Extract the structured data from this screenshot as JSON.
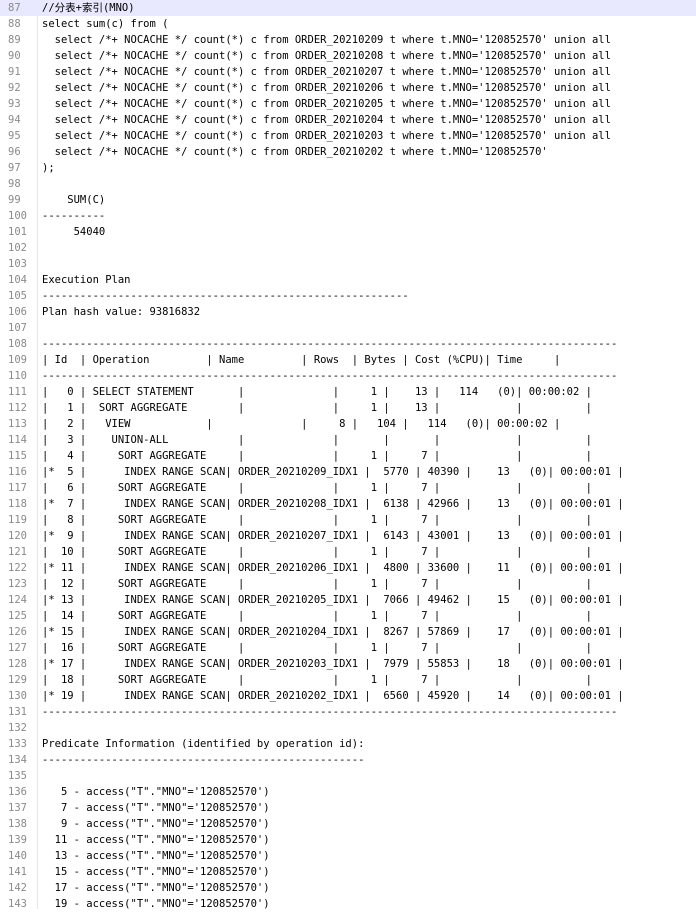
{
  "editor": {
    "lines": [
      {
        "n": "87",
        "t": "//分表+索引(MNO)"
      },
      {
        "n": "88",
        "t": "select sum(c) from ("
      },
      {
        "n": "89",
        "t": "  select /*+ NOCACHE */ count(*) c from ORDER_20210209 t where t.MNO='120852570' union all"
      },
      {
        "n": "90",
        "t": "  select /*+ NOCACHE */ count(*) c from ORDER_20210208 t where t.MNO='120852570' union all"
      },
      {
        "n": "91",
        "t": "  select /*+ NOCACHE */ count(*) c from ORDER_20210207 t where t.MNO='120852570' union all"
      },
      {
        "n": "92",
        "t": "  select /*+ NOCACHE */ count(*) c from ORDER_20210206 t where t.MNO='120852570' union all"
      },
      {
        "n": "93",
        "t": "  select /*+ NOCACHE */ count(*) c from ORDER_20210205 t where t.MNO='120852570' union all"
      },
      {
        "n": "94",
        "t": "  select /*+ NOCACHE */ count(*) c from ORDER_20210204 t where t.MNO='120852570' union all"
      },
      {
        "n": "95",
        "t": "  select /*+ NOCACHE */ count(*) c from ORDER_20210203 t where t.MNO='120852570' union all"
      },
      {
        "n": "96",
        "t": "  select /*+ NOCACHE */ count(*) c from ORDER_20210202 t where t.MNO='120852570'"
      },
      {
        "n": "97",
        "t": ");"
      },
      {
        "n": "98",
        "t": ""
      },
      {
        "n": "99",
        "t": "    SUM(C)"
      },
      {
        "n": "100",
        "t": "----------"
      },
      {
        "n": "101",
        "t": "     54040"
      },
      {
        "n": "102",
        "t": ""
      },
      {
        "n": "103",
        "t": ""
      },
      {
        "n": "104",
        "t": "Execution Plan"
      },
      {
        "n": "105",
        "t": "----------------------------------------------------------"
      },
      {
        "n": "106",
        "t": "Plan hash value: 93816832"
      },
      {
        "n": "107",
        "t": ""
      },
      {
        "n": "108",
        "t": "-------------------------------------------------------------------------------------------"
      },
      {
        "n": "109",
        "t": "| Id  | Operation         | Name         | Rows  | Bytes | Cost (%CPU)| Time     |"
      },
      {
        "n": "110",
        "t": "-------------------------------------------------------------------------------------------"
      },
      {
        "n": "111",
        "t": "|   0 | SELECT STATEMENT       |              |     1 |    13 |   114   (0)| 00:00:02 |"
      },
      {
        "n": "112",
        "t": "|   1 |  SORT AGGREGATE        |              |     1 |    13 |            |          |"
      },
      {
        "n": "113",
        "t": "|   2 |   VIEW            |              |     8 |   104 |   114   (0)| 00:00:02 |"
      },
      {
        "n": "114",
        "t": "|   3 |    UNION-ALL           |              |       |       |            |          |"
      },
      {
        "n": "115",
        "t": "|   4 |     SORT AGGREGATE     |              |     1 |     7 |            |          |"
      },
      {
        "n": "116",
        "t": "|*  5 |      INDEX RANGE SCAN| ORDER_20210209_IDX1 |  5770 | 40390 |    13   (0)| 00:00:01 |"
      },
      {
        "n": "117",
        "t": "|   6 |     SORT AGGREGATE     |              |     1 |     7 |            |          |"
      },
      {
        "n": "118",
        "t": "|*  7 |      INDEX RANGE SCAN| ORDER_20210208_IDX1 |  6138 | 42966 |    13   (0)| 00:00:01 |"
      },
      {
        "n": "119",
        "t": "|   8 |     SORT AGGREGATE     |              |     1 |     7 |            |          |"
      },
      {
        "n": "120",
        "t": "|*  9 |      INDEX RANGE SCAN| ORDER_20210207_IDX1 |  6143 | 43001 |    13   (0)| 00:00:01 |"
      },
      {
        "n": "121",
        "t": "|  10 |     SORT AGGREGATE     |              |     1 |     7 |            |          |"
      },
      {
        "n": "122",
        "t": "|* 11 |      INDEX RANGE SCAN| ORDER_20210206_IDX1 |  4800 | 33600 |    11   (0)| 00:00:01 |"
      },
      {
        "n": "123",
        "t": "|  12 |     SORT AGGREGATE     |              |     1 |     7 |            |          |"
      },
      {
        "n": "124",
        "t": "|* 13 |      INDEX RANGE SCAN| ORDER_20210205_IDX1 |  7066 | 49462 |    15   (0)| 00:00:01 |"
      },
      {
        "n": "125",
        "t": "|  14 |     SORT AGGREGATE     |              |     1 |     7 |            |          |"
      },
      {
        "n": "126",
        "t": "|* 15 |      INDEX RANGE SCAN| ORDER_20210204_IDX1 |  8267 | 57869 |    17   (0)| 00:00:01 |"
      },
      {
        "n": "127",
        "t": "|  16 |     SORT AGGREGATE     |              |     1 |     7 |            |          |"
      },
      {
        "n": "128",
        "t": "|* 17 |      INDEX RANGE SCAN| ORDER_20210203_IDX1 |  7979 | 55853 |    18   (0)| 00:00:01 |"
      },
      {
        "n": "129",
        "t": "|  18 |     SORT AGGREGATE     |              |     1 |     7 |            |          |"
      },
      {
        "n": "130",
        "t": "|* 19 |      INDEX RANGE SCAN| ORDER_20210202_IDX1 |  6560 | 45920 |    14   (0)| 00:00:01 |"
      },
      {
        "n": "131",
        "t": "-------------------------------------------------------------------------------------------"
      },
      {
        "n": "132",
        "t": ""
      },
      {
        "n": "133",
        "t": "Predicate Information (identified by operation id):"
      },
      {
        "n": "134",
        "t": "---------------------------------------------------"
      },
      {
        "n": "135",
        "t": ""
      },
      {
        "n": "136",
        "t": "   5 - access(\"T\".\"MNO\"='120852570')"
      },
      {
        "n": "137",
        "t": "   7 - access(\"T\".\"MNO\"='120852570')"
      },
      {
        "n": "138",
        "t": "   9 - access(\"T\".\"MNO\"='120852570')"
      },
      {
        "n": "139",
        "t": "  11 - access(\"T\".\"MNO\"='120852570')"
      },
      {
        "n": "140",
        "t": "  13 - access(\"T\".\"MNO\"='120852570')"
      },
      {
        "n": "141",
        "t": "  15 - access(\"T\".\"MNO\"='120852570')"
      },
      {
        "n": "142",
        "t": "  17 - access(\"T\".\"MNO\"='120852570')"
      },
      {
        "n": "143",
        "t": "  19 - access(\"T\".\"MNO\"='120852570')"
      }
    ]
  }
}
